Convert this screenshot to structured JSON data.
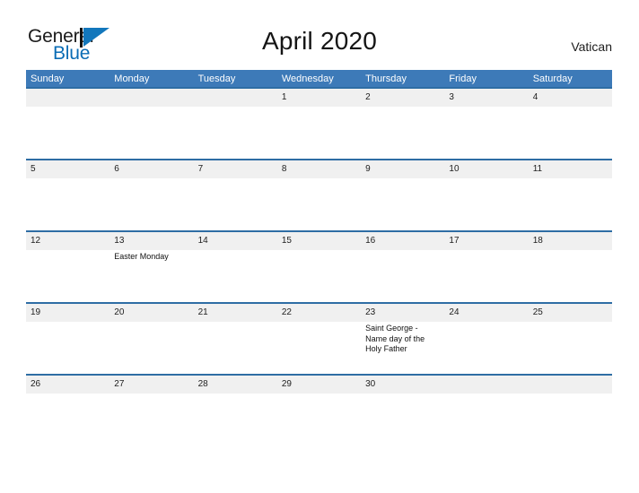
{
  "brand": {
    "name_part1": "General",
    "name_part2": "Blue",
    "mark": "triangle-logo"
  },
  "header": {
    "title": "April 2020",
    "locale": "Vatican"
  },
  "calendar": {
    "weekday_headers": [
      "Sunday",
      "Monday",
      "Tuesday",
      "Wednesday",
      "Thursday",
      "Friday",
      "Saturday"
    ],
    "accent_color": "#3d7ab8",
    "row_band_color": "#f0f0f0",
    "separator_color": "#2e6da4",
    "weeks": [
      [
        {
          "day": ""
        },
        {
          "day": ""
        },
        {
          "day": ""
        },
        {
          "day": "1",
          "events": []
        },
        {
          "day": "2",
          "events": []
        },
        {
          "day": "3",
          "events": []
        },
        {
          "day": "4",
          "events": []
        }
      ],
      [
        {
          "day": "5",
          "events": []
        },
        {
          "day": "6",
          "events": []
        },
        {
          "day": "7",
          "events": []
        },
        {
          "day": "8",
          "events": []
        },
        {
          "day": "9",
          "events": []
        },
        {
          "day": "10",
          "events": []
        },
        {
          "day": "11",
          "events": []
        }
      ],
      [
        {
          "day": "12",
          "events": []
        },
        {
          "day": "13",
          "events": [
            "Easter Monday"
          ]
        },
        {
          "day": "14",
          "events": []
        },
        {
          "day": "15",
          "events": []
        },
        {
          "day": "16",
          "events": []
        },
        {
          "day": "17",
          "events": []
        },
        {
          "day": "18",
          "events": []
        }
      ],
      [
        {
          "day": "19",
          "events": []
        },
        {
          "day": "20",
          "events": []
        },
        {
          "day": "21",
          "events": []
        },
        {
          "day": "22",
          "events": []
        },
        {
          "day": "23",
          "events": [
            "Saint George - Name day of the Holy Father"
          ]
        },
        {
          "day": "24",
          "events": []
        },
        {
          "day": "25",
          "events": []
        }
      ],
      [
        {
          "day": "26",
          "events": []
        },
        {
          "day": "27",
          "events": []
        },
        {
          "day": "28",
          "events": []
        },
        {
          "day": "29",
          "events": []
        },
        {
          "day": "30",
          "events": []
        },
        {
          "day": ""
        },
        {
          "day": ""
        }
      ]
    ]
  }
}
